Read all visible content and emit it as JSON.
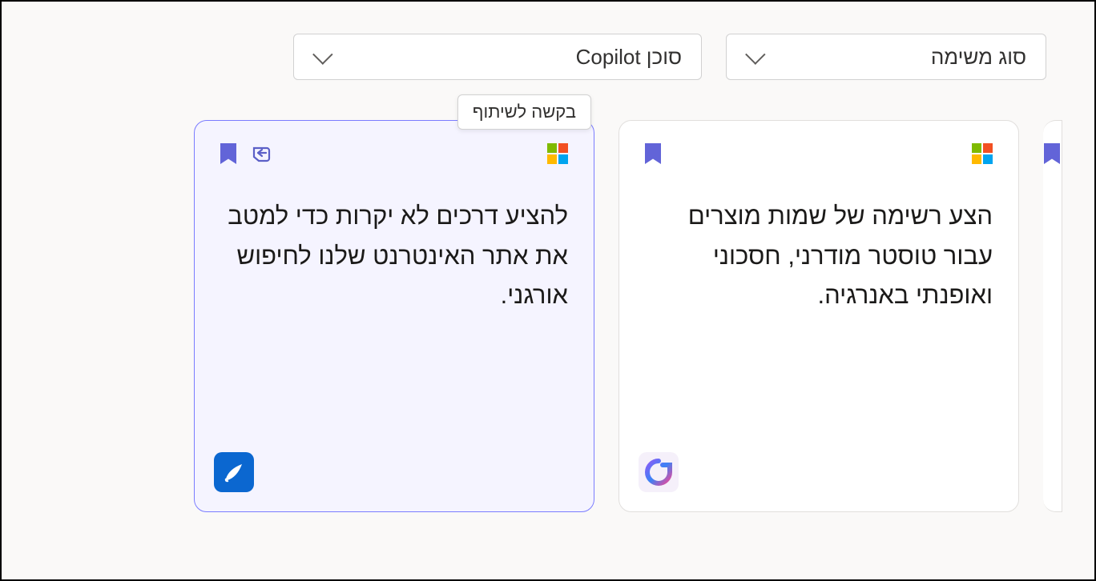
{
  "filters": {
    "task_type": {
      "label": "סוג משימה"
    },
    "copilot_agent": {
      "label": "סוכן Copilot"
    }
  },
  "tooltip": {
    "share_request": "בקשה לשיתוף"
  },
  "cards": [
    {
      "text": "הצע רשימה של שמות מוצרים עבור טוסטר מודרני, חסכוני ואופנתי באנרגיה."
    },
    {
      "text": "להציע דרכים לא יקרות כדי למטב את אתר האינטרנט שלנו לחיפוש אורגני."
    }
  ]
}
